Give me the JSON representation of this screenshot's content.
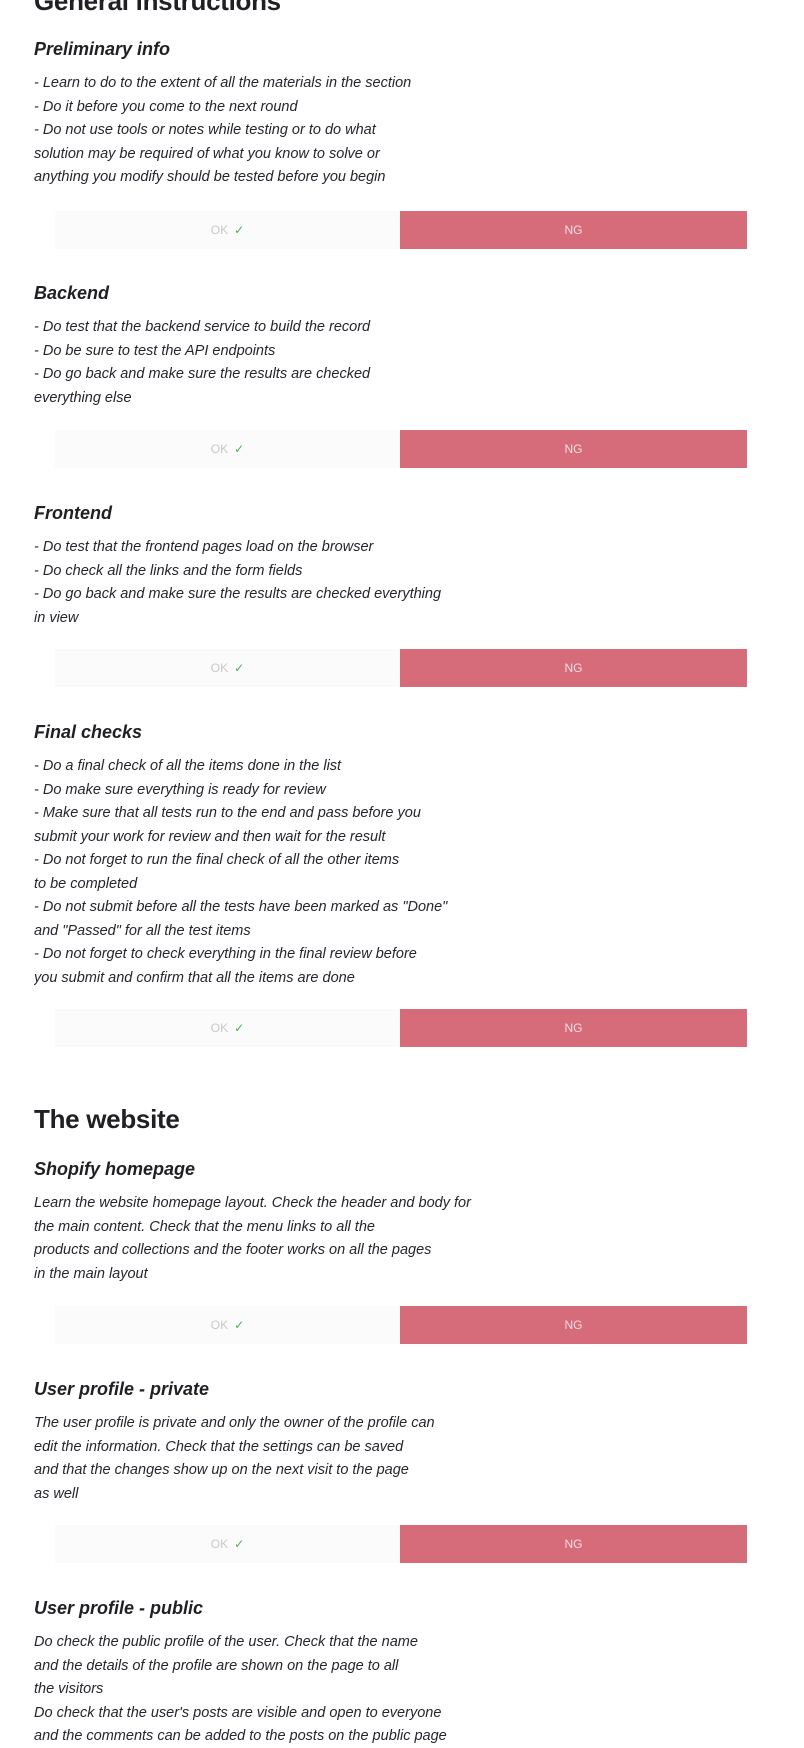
{
  "sections": [
    {
      "title": "General instructions"
    },
    {
      "title": "The website"
    }
  ],
  "blocks": [
    {
      "title": "Preliminary info",
      "lines": [
        "- Learn to do to the extent of all the materials in the section",
        "- Do it before you come to the next round",
        "- Do not use tools or notes while testing or to do what",
        "solution may be required of what you know to solve or",
        "anything you modify should be tested before you begin"
      ],
      "ok_label": "OK",
      "ok_icon": "check-icon",
      "ng_label": "NG"
    },
    {
      "title": "Backend",
      "lines": [
        "- Do test that the backend service to build the record",
        "- Do be sure to test the API endpoints",
        "- Do go back and make sure the results are checked",
        "everything else"
      ],
      "ok_label": "OK",
      "ok_icon": "check-icon",
      "ng_label": "NG"
    },
    {
      "title": "Frontend",
      "lines": [
        "- Do test that the frontend pages load on the browser",
        "- Do check all the links and the form fields",
        "- Do go back and make sure the results are checked everything",
        "in view"
      ],
      "ok_label": "OK",
      "ok_icon": "check-icon",
      "ng_label": "NG"
    },
    {
      "title": "Final checks",
      "lines": [
        "- Do a final check of all the items done in the list",
        "- Do make sure everything is ready for review",
        "- Make sure that all tests run to the end and pass before you",
        "submit your work for review and then wait for the result",
        "- Do not forget to run the final check of all the other items",
        "to be completed",
        "- Do not submit before all the tests have been marked as \"Done\"",
        "and \"Passed\" for all the test items",
        "- Do not forget to check everything in the final review before",
        "you submit and confirm that all the items are done"
      ],
      "ok_label": "OK",
      "ok_icon": "check-icon",
      "ng_label": "NG"
    },
    {
      "title": "Shopify homepage",
      "lines": [
        "Learn the website homepage layout. Check the header and body for",
        "the main content. Check that the menu links to all the",
        "products and collections and the footer works on all the pages",
        "in the main layout"
      ],
      "ok_label": "OK",
      "ok_icon": "check-icon",
      "ng_label": "NG"
    },
    {
      "title": "User profile - private",
      "lines": [
        "The user profile is private and only the owner of the profile can",
        "edit the information. Check that the settings can be saved",
        "and that the changes show up on the next visit to the page",
        "as well"
      ],
      "ok_label": "OK",
      "ok_icon": "check-icon",
      "ng_label": "NG"
    },
    {
      "title": "User profile - public",
      "lines": [
        "Do check the public profile of the user. Check that the name",
        "and the details of the profile are shown on the page to all",
        "the visitors",
        "Do check that the user's posts are visible and open to everyone",
        "and the comments can be added to the posts on the public page"
      ]
    }
  ]
}
